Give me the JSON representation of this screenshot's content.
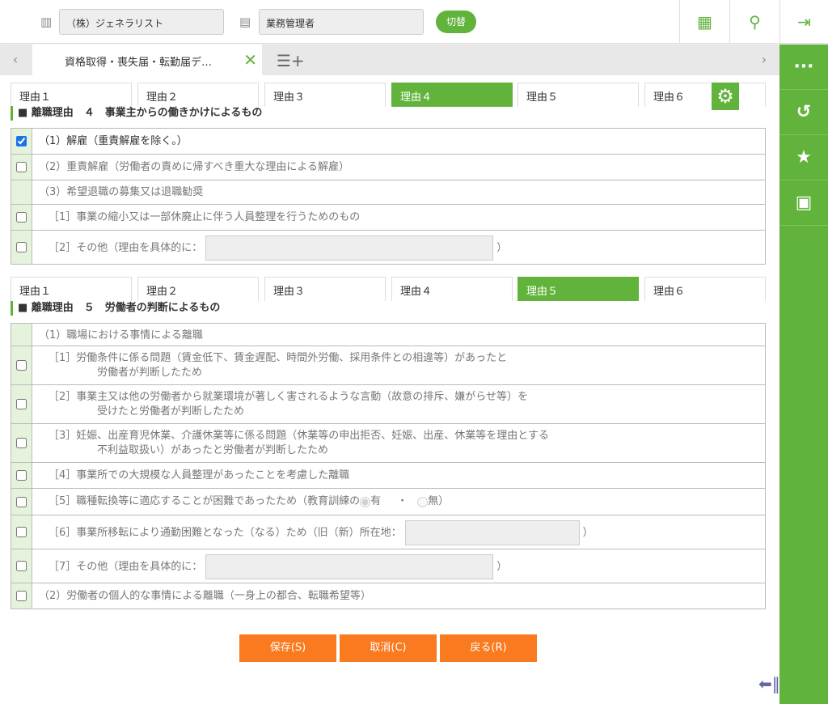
{
  "header": {
    "company": "（株）ジェネラリスト",
    "role": "業務管理者",
    "switch_label": "切替"
  },
  "tabbar": {
    "tab_label": "資格取得・喪失届・転勤届デ…"
  },
  "reason_tabs": [
    "理由１",
    "理由２",
    "理由３",
    "理由４",
    "理由５",
    "理由６"
  ],
  "section4": {
    "title": "■ 離職理由　４　事業主からの働きかけによるもの",
    "rows": [
      {
        "label": "（1）解雇（重責解雇を除く。）",
        "checked": true
      },
      {
        "label": "（2）重責解雇（労働者の責めに帰すべき重大な理由による解雇）"
      },
      {
        "label": "（3）希望退職の募集又は退職勧奨"
      },
      {
        "label": "［1］事業の縮小又は一部休廃止に伴う人員整理を行うためのもの"
      },
      {
        "label": "［2］その他（理由を具体的に：",
        "suffix": "）"
      }
    ]
  },
  "section5": {
    "title": "■ 離職理由　５　労働者の判断によるもの",
    "rows": [
      {
        "label": "（1）職場における事情による離職"
      },
      {
        "label": "［1］労働条件に係る問題（賃金低下、賃金遅配、時間外労働、採用条件との相違等）があったと",
        "line2": "労働者が判断したため"
      },
      {
        "label": "［2］事業主又は他の労働者から就業環境が著しく害されるような言動（故意の排斥、嫌がらせ等）を",
        "line2": "受けたと労働者が判断したため"
      },
      {
        "label": "［3］妊娠、出産育児休業、介護休業等に係る問題（休業等の申出拒否、妊娠、出産、休業等を理由とする",
        "line2": "不利益取扱い）があったと労働者が判断したため"
      },
      {
        "label": "［4］事業所での大規模な人員整理があったことを考慮した離職"
      },
      {
        "label": "［5］職種転換等に適応することが困難であったため（教育訓練の",
        "opt_yes": "有",
        "sep": "・",
        "opt_no": "無",
        "suffix": "）"
      },
      {
        "label": "［6］事業所移転により通勤困難となった（なる）ため（旧（新）所在地：",
        "suffix": "）"
      },
      {
        "label": "［7］その他（理由を具体的に：",
        "suffix": "）"
      },
      {
        "label": "（2）労働者の個人的な事情による離職（一身上の都合、転職希望等）"
      }
    ]
  },
  "buttons": {
    "save": "保存(S)",
    "cancel": "取消(C)",
    "back": "戻る(R)"
  },
  "colors": {
    "accent": "#62b33c",
    "button": "#f97a1f"
  }
}
